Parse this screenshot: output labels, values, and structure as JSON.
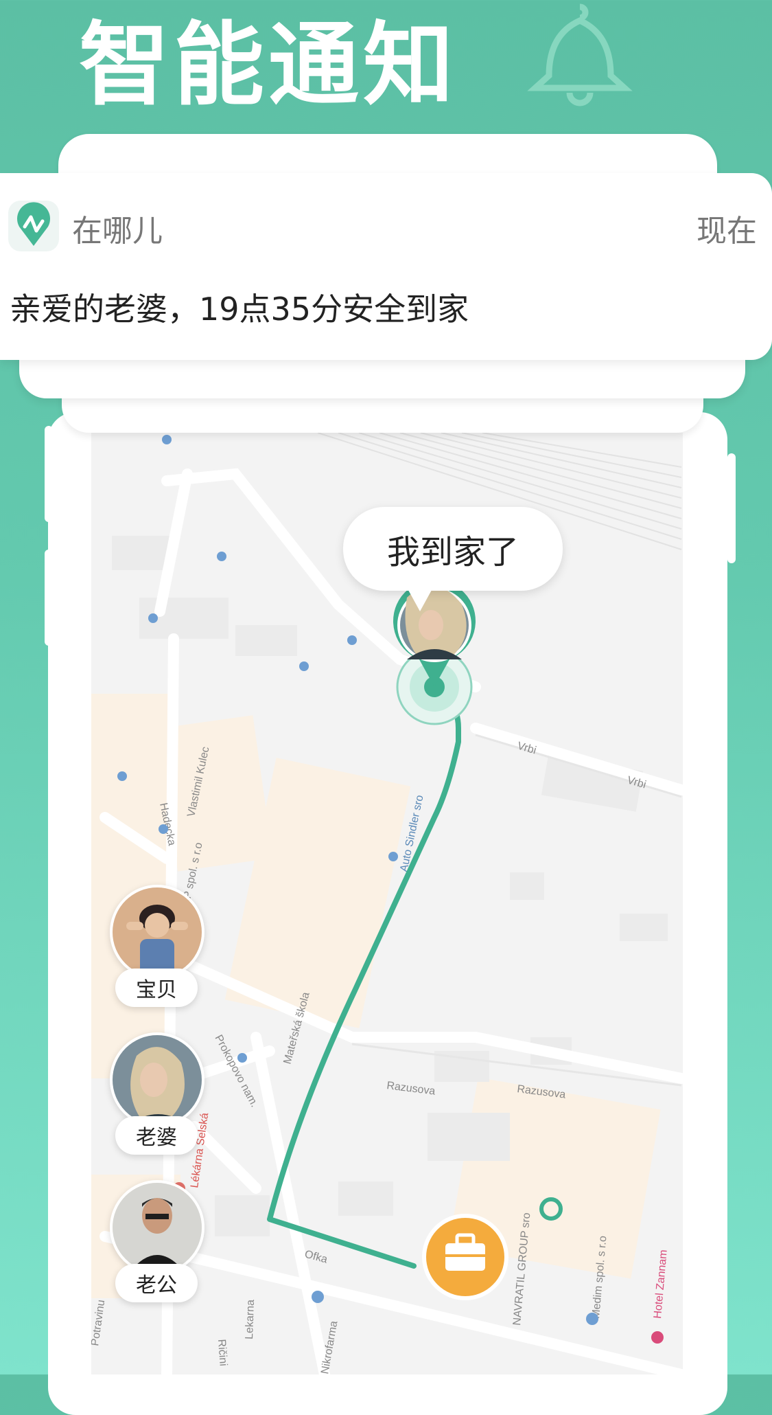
{
  "promo": {
    "headline": "智能通知"
  },
  "notification": {
    "app_name": "在哪儿",
    "time": "现在",
    "message": "亲爱的老婆，19点35分安全到家"
  },
  "map": {
    "bubble_text": "我到家了",
    "members": [
      {
        "label": "宝贝"
      },
      {
        "label": "老婆"
      },
      {
        "label": "老公"
      }
    ],
    "street_labels": [
      "Razusova",
      "Razusova",
      "Vrbi",
      "Vrbi",
      "Prokopovo nam.",
      "Mateřská škola",
      "Potravinu",
      "Ričini",
      "Medim spol. s r.o",
      "NAVRATIL GROUP sro",
      "Hotel Zannam",
      "Auto Sindler sro",
      "Vlastimil Kulec",
      "AKP spol. s r.o",
      "Lékárna Selská",
      "Hadecka",
      "Lekarna",
      "Nikrofarma",
      "Ofka"
    ]
  },
  "colors": {
    "brand_green": "#5cbfa4",
    "route_green": "#3fb08f",
    "work_orange": "#f4ab3d",
    "map_bg": "#f3f3f3"
  },
  "icons": {
    "bell": "bell-icon",
    "app": "location-pin-logo-icon",
    "work": "briefcase-icon",
    "poi": "map-pin-icon"
  }
}
